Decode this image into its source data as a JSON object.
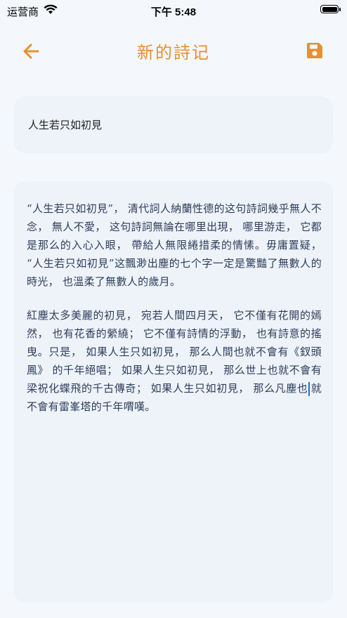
{
  "status_bar": {
    "carrier": "运营商",
    "time": "下午 5:48",
    "battery_level": 1.0
  },
  "nav": {
    "title": "新的詩记",
    "back_icon": "arrow-left-icon",
    "save_icon": "floppy-disk-icon",
    "accent_color": "#e88f2f"
  },
  "editor": {
    "title_value": "人生若只如初見",
    "paragraph_1": "“人生若只如初見”， 清代詞人納蘭性德的这句詩詞幾乎無人不念， 無人不愛， 这句詩詞無論在哪里出現， 哪里游走， 它都是那么的入心入眼， 帶給人無限綣措柔的情愫。毋庸置疑， “人生若只如初見”这飄渺出塵的七个字一定是驚豔了無數人的時光， 也溫柔了無數人的歲月。",
    "paragraph_2_before_caret": "紅塵太多美麗的初見， 宛若人間四月天， 它不僅有花開的嫣然， 也有花香的縈繞； 它不僅有詩情的浮動， 也有詩意的搖曳。只是， 如果人生只如初見， 那么人間也就不會有《釵頭鳳》 的千年絕唱； 如果人生只如初見， 那么世上也就不會有梁祝化蝶飛的千古傳奇； 如果人生只如初見， 那么凡塵也",
    "paragraph_2_after_caret": "就不會有雷峯塔的千年喟嘆。"
  }
}
